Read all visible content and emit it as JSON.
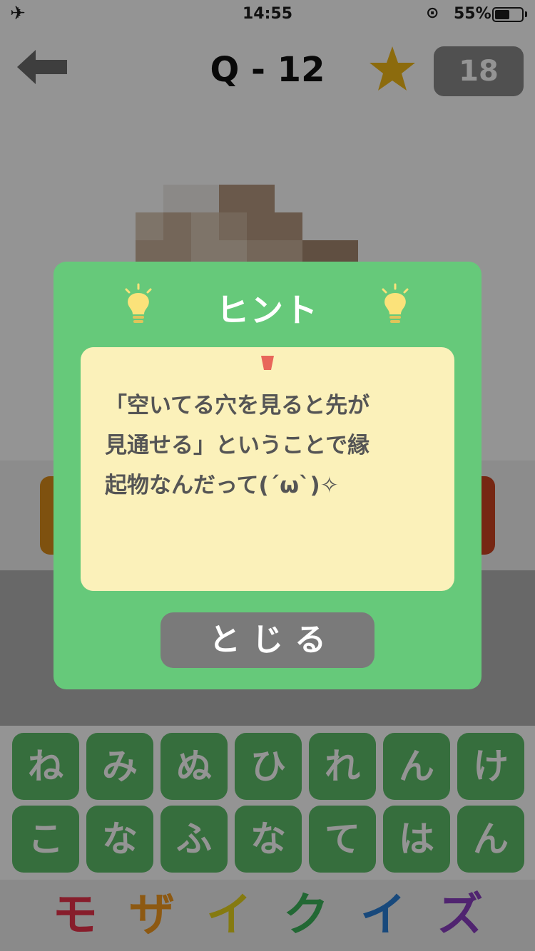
{
  "status_bar": {
    "time": "14:55",
    "battery_percent": "55%",
    "battery_level": 0.55,
    "icons": [
      "airplane-icon",
      "rotation-lock-icon",
      "battery-icon"
    ]
  },
  "header": {
    "title": "Q - 12",
    "star_count": "18",
    "back_icon": "left-arrow-icon",
    "star_icon": "star-icon"
  },
  "keyboard": {
    "row1": [
      "ね",
      "み",
      "ぬ",
      "ひ",
      "れ",
      "ん",
      "け"
    ],
    "row2": [
      "こ",
      "な",
      "ふ",
      "な",
      "て",
      "は",
      "ん"
    ]
  },
  "footer": {
    "logo_chars": [
      "モ",
      "ザ",
      "イ",
      "ク",
      "イ",
      "ズ"
    ],
    "logo_colors": [
      "#e8334a",
      "#f39a1f",
      "#e6d21c",
      "#3cb35a",
      "#2a7fd6",
      "#8a3fc2"
    ]
  },
  "hint_modal": {
    "title": "ヒント",
    "text": "「空いてる穴を見ると先が\n見通せる」ということで縁\n起物なんだって(´ω`)✧",
    "close_label": "とじる",
    "icons": [
      "lightbulb-icon",
      "pin-icon"
    ]
  },
  "colors": {
    "modal_green": "#66c97a",
    "hint_paper": "#fbf1ba",
    "key_green": "#5dbe69",
    "close_gray": "#7a7a7a",
    "star_gold": "#f2b817"
  }
}
